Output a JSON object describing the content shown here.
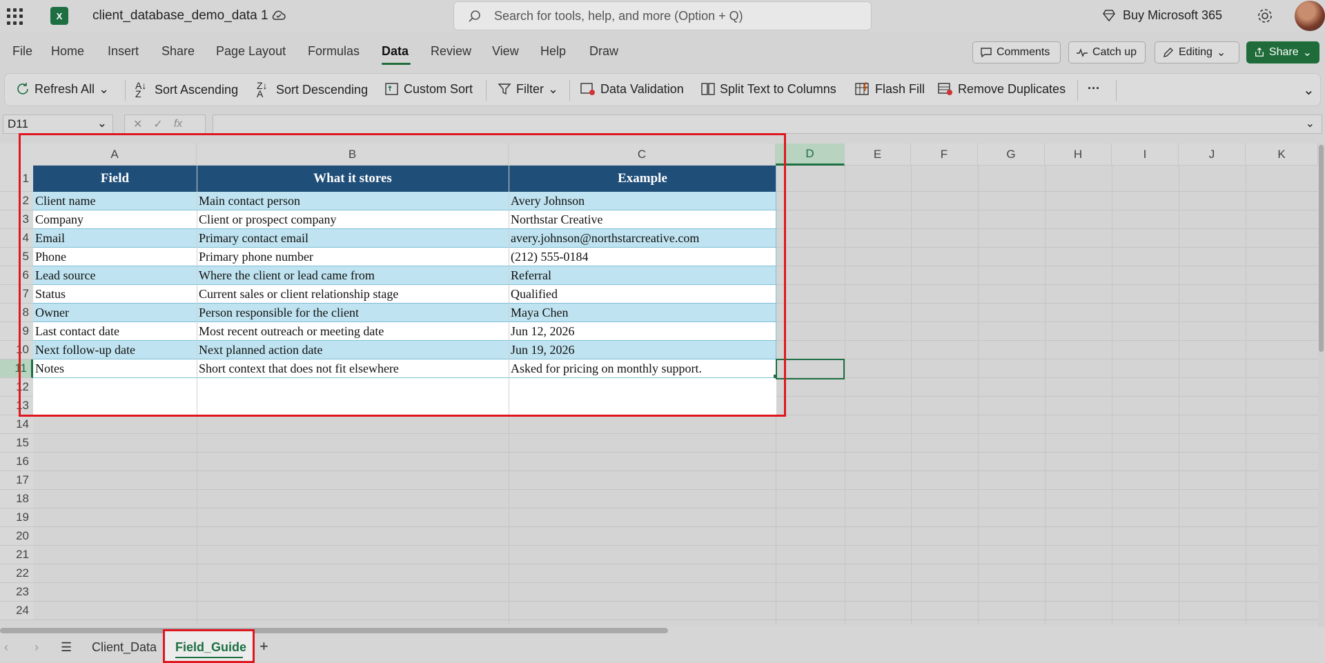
{
  "app": {
    "doc_title": "client_database_demo_data 1",
    "search_placeholder": "Search for tools, help, and more (Option + Q)",
    "buy_label": "Buy Microsoft 365"
  },
  "menu": {
    "items": [
      "File",
      "Home",
      "Insert",
      "Share",
      "Page Layout",
      "Formulas",
      "Data",
      "Review",
      "View",
      "Help",
      "Draw"
    ],
    "active": "Data",
    "comments": "Comments",
    "catch_up": "Catch up",
    "editing": "Editing",
    "share": "Share"
  },
  "ribbon": {
    "refresh_all": "Refresh All",
    "sort_ascending": "Sort Ascending",
    "sort_descending": "Sort Descending",
    "custom_sort": "Custom Sort",
    "filter": "Filter",
    "data_validation": "Data Validation",
    "split_text": "Split Text to Columns",
    "flash_fill": "Flash Fill",
    "remove_duplicates": "Remove Duplicates",
    "more": "···"
  },
  "formula_bar": {
    "name_box": "D11",
    "fx": "fx",
    "content": ""
  },
  "grid": {
    "columns": [
      "A",
      "B",
      "C",
      "D",
      "E",
      "F",
      "G",
      "H",
      "I",
      "J",
      "K"
    ],
    "rows": [
      "1",
      "2",
      "3",
      "4",
      "5",
      "6",
      "7",
      "8",
      "9",
      "10",
      "11",
      "12",
      "13",
      "14",
      "15",
      "16",
      "17",
      "18",
      "19",
      "20",
      "21",
      "22",
      "23",
      "24"
    ],
    "selected_cell": "D11"
  },
  "table": {
    "headers": [
      "Field",
      "What it stores",
      "Example"
    ],
    "rows": [
      [
        "Client name",
        "Main contact person",
        "Avery Johnson"
      ],
      [
        "Company",
        "Client or prospect company",
        "Northstar Creative"
      ],
      [
        "Email",
        "Primary contact email",
        "avery.johnson@northstarcreative.com"
      ],
      [
        "Phone",
        "Primary phone number",
        "(212) 555-0184"
      ],
      [
        "Lead source",
        "Where the client or lead came from",
        "Referral"
      ],
      [
        "Status",
        "Current sales or client relationship stage",
        "Qualified"
      ],
      [
        "Owner",
        "Person responsible for the client",
        "Maya Chen"
      ],
      [
        "Last contact date",
        "Most recent outreach or meeting date",
        "Jun 12, 2026"
      ],
      [
        "Next follow-up date",
        "Next planned action date",
        "Jun 19, 2026"
      ],
      [
        "Notes",
        "Short context that does not fit elsewhere",
        "Asked for pricing on monthly support."
      ]
    ]
  },
  "sheets": {
    "tabs": [
      "Client_Data",
      "Field_Guide"
    ],
    "active": "Field_Guide"
  },
  "colors": {
    "header_bg": "#1f4e79",
    "band": "#bfe3f0",
    "accent": "#1d6f42",
    "highlight": "#e0161e"
  }
}
